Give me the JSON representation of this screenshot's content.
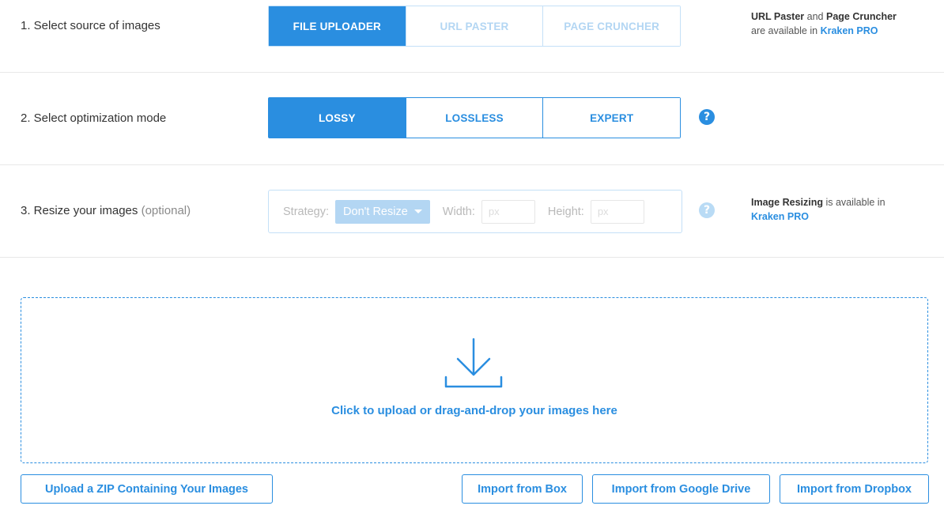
{
  "step1": {
    "label": "1. Select source of images",
    "options": [
      "FILE UPLOADER",
      "URL PASTER",
      "PAGE CRUNCHER"
    ],
    "active": "FILE UPLOADER",
    "note": {
      "part1": "URL Paster",
      "part2": " and ",
      "part3": "Page Cruncher",
      "part4": "are available in ",
      "link": "Kraken PRO"
    }
  },
  "step2": {
    "label": "2. Select optimization mode",
    "options": [
      "LOSSY",
      "LOSSLESS",
      "EXPERT"
    ],
    "active": "LOSSY",
    "help_icon": "question-circle-icon"
  },
  "step3": {
    "label": "3. Resize your images",
    "optional": "(optional)",
    "strategy_label": "Strategy:",
    "strategy_value": "Don't Resize",
    "width_label": "Width:",
    "width_placeholder": "px",
    "height_label": "Height:",
    "height_placeholder": "px",
    "note": {
      "part1": "Image Resizing",
      "part2": " is available in",
      "link": "Kraken PRO"
    }
  },
  "dropzone": {
    "icon": "download-tray-icon",
    "text": "Click to upload or drag-and-drop your images here"
  },
  "buttons": {
    "zip": "Upload a ZIP Containing Your Images",
    "box": "Import from Box",
    "gdrive": "Import from Google Drive",
    "dropbox": "Import from Dropbox"
  },
  "colors": {
    "accent": "#2a8ee0",
    "accent_faded": "#b3d6f3",
    "divider": "#e8e8e8"
  }
}
